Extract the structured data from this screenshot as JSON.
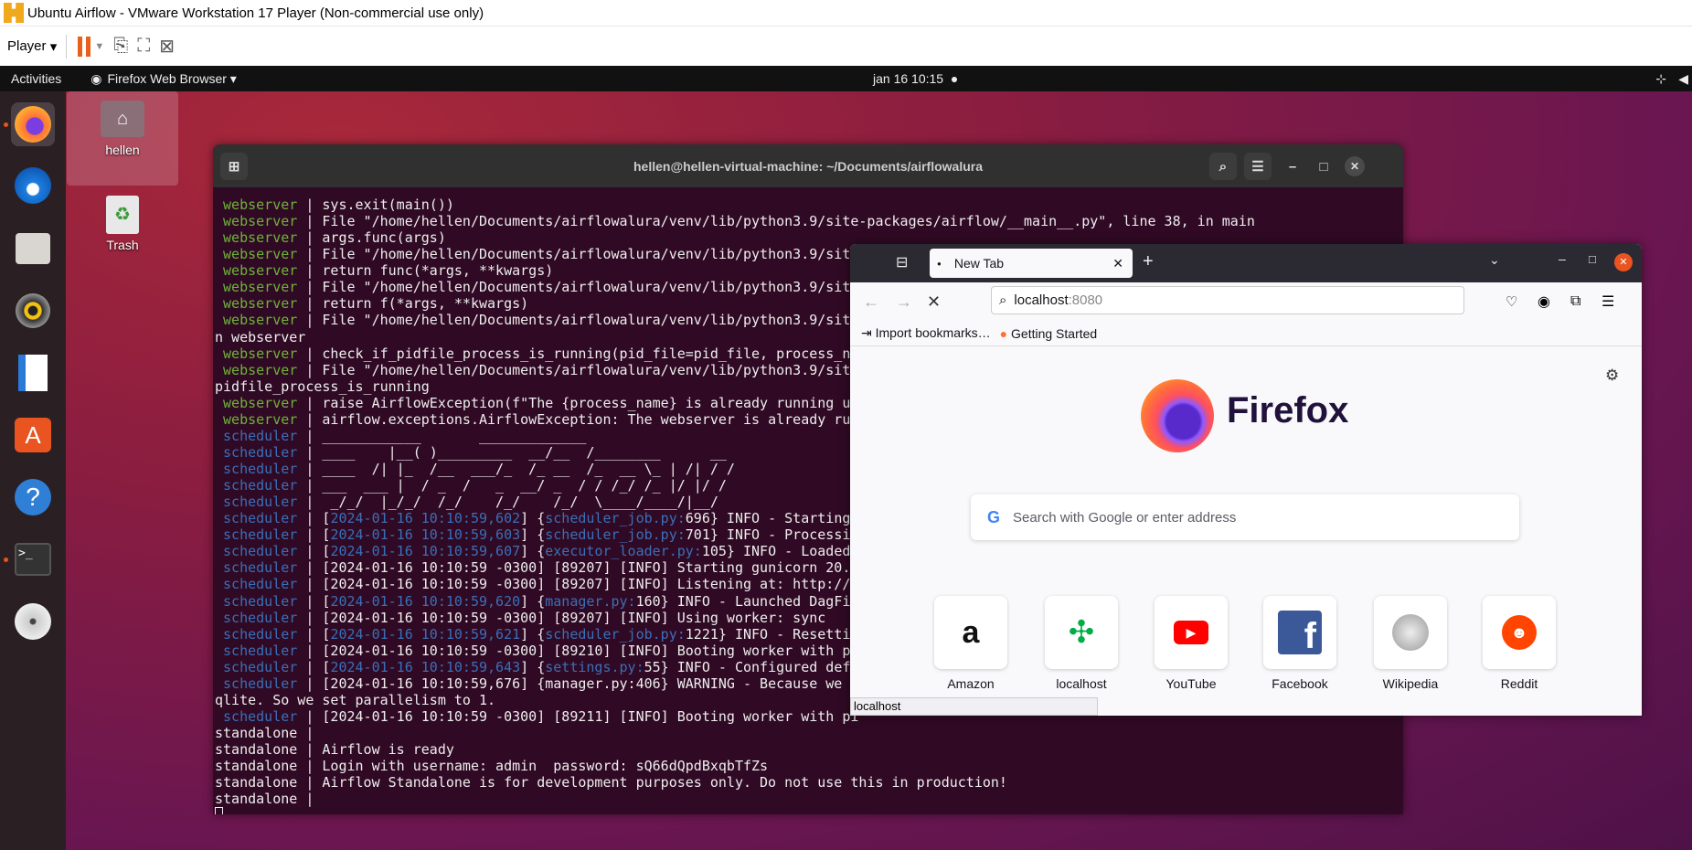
{
  "vm": {
    "title": "Ubuntu Airflow - VMware Workstation 17 Player (Non-commercial use only)",
    "player_menu": "Player"
  },
  "topbar": {
    "activities": "Activities",
    "app": "Firefox Web Browser",
    "clock": "jan 16  10:15"
  },
  "desktop": {
    "home": "hellen",
    "trash": "Trash"
  },
  "dock": [
    "firefox-icon",
    "thunderbird-icon",
    "files-icon",
    "rhythmbox-icon",
    "writer-icon",
    "app-center-icon",
    "help-icon",
    "terminal-icon",
    "dvd-icon"
  ],
  "terminal": {
    "title": "hellen@hellen-virtual-machine: ~/Documents/airflowalura",
    "lines": [
      [
        [
          " webserver",
          "g"
        ],
        [
          " | sys.exit(main())",
          ""
        ]
      ],
      [
        [
          " webserver",
          "g"
        ],
        [
          " | File \"/home/hellen/Documents/airflowalura/venv/lib/python3.9/site-packages/airflow/__main__.py\", line 38, in main",
          ""
        ]
      ],
      [
        [
          " webserver",
          "g"
        ],
        [
          " | args.func(args)",
          ""
        ]
      ],
      [
        [
          " webserver",
          "g"
        ],
        [
          " | File \"/home/hellen/Documents/airflowalura/venv/lib/python3.9/site",
          ""
        ]
      ],
      [
        [
          " webserver",
          "g"
        ],
        [
          " | return func(*args, **kwargs)",
          ""
        ]
      ],
      [
        [
          " webserver",
          "g"
        ],
        [
          " | File \"/home/hellen/Documents/airflowalura/venv/lib/python3.9/site",
          ""
        ]
      ],
      [
        [
          " webserver",
          "g"
        ],
        [
          " | return f(*args, **kwargs)",
          ""
        ]
      ],
      [
        [
          " webserver",
          "g"
        ],
        [
          " | File \"/home/hellen/Documents/airflowalura/venv/lib/python3.9/site",
          ""
        ]
      ],
      [
        [
          "n webserver",
          ""
        ]
      ],
      [
        [
          " webserver",
          "g"
        ],
        [
          " | check_if_pidfile_process_is_running(pid_file=pid_file, process_na",
          ""
        ]
      ],
      [
        [
          " webserver",
          "g"
        ],
        [
          " | File \"/home/hellen/Documents/airflowalura/venv/lib/python3.9/site",
          ""
        ]
      ],
      [
        [
          "pidfile_process_is_running",
          ""
        ]
      ],
      [
        [
          " webserver",
          "g"
        ],
        [
          " | raise AirflowException(f\"The {process_name} is already running u",
          ""
        ]
      ],
      [
        [
          " webserver",
          "g"
        ],
        [
          " | airflow.exceptions.AirflowException: The webserver is already ru",
          ""
        ]
      ],
      [
        [
          " scheduler",
          "b"
        ],
        [
          " | ____________       _____________",
          ""
        ]
      ],
      [
        [
          " scheduler",
          "b"
        ],
        [
          " | ____    |__( )_________  __/__  /________      __",
          ""
        ]
      ],
      [
        [
          " scheduler",
          "b"
        ],
        [
          " | ____  /| |_  /__  ___/_  /_ __  /_  __ \\_ | /| / /",
          ""
        ]
      ],
      [
        [
          " scheduler",
          "b"
        ],
        [
          " | ___  ___ |  / _  /   _  __/ _  / / /_/ /_ |/ |/ /",
          ""
        ]
      ],
      [
        [
          " scheduler",
          "b"
        ],
        [
          " |  _/_/  |_/_/  /_/    /_/    /_/  \\____/____/|__/",
          ""
        ]
      ],
      [
        [
          " scheduler",
          "b"
        ],
        [
          " | [",
          ""
        ],
        [
          "2024-01-16 10:10:59,602",
          "b"
        ],
        [
          "] {",
          ""
        ],
        [
          "scheduler_job.py:",
          "b"
        ],
        [
          "696} INFO - Starting",
          ""
        ]
      ],
      [
        [
          " scheduler",
          "b"
        ],
        [
          " | [",
          ""
        ],
        [
          "2024-01-16 10:10:59,603",
          "b"
        ],
        [
          "] {",
          ""
        ],
        [
          "scheduler_job.py:",
          "b"
        ],
        [
          "701} INFO - Processin",
          ""
        ]
      ],
      [
        [
          " scheduler",
          "b"
        ],
        [
          " | [",
          ""
        ],
        [
          "2024-01-16 10:10:59,607",
          "b"
        ],
        [
          "] {",
          ""
        ],
        [
          "executor_loader.py:",
          "b"
        ],
        [
          "105} INFO - Loaded",
          ""
        ]
      ],
      [
        [
          " scheduler",
          "b"
        ],
        [
          " | [2024-01-16 10:10:59 -0300] [89207] [INFO] Starting gunicorn 20.1",
          ""
        ]
      ],
      [
        [
          " scheduler",
          "b"
        ],
        [
          " | [2024-01-16 10:10:59 -0300] [89207] [INFO] Listening at: http://0",
          ""
        ]
      ],
      [
        [
          " scheduler",
          "b"
        ],
        [
          " | [",
          ""
        ],
        [
          "2024-01-16 10:10:59,620",
          "b"
        ],
        [
          "] {",
          ""
        ],
        [
          "manager.py:",
          "b"
        ],
        [
          "160} INFO - Launched DagFil",
          ""
        ]
      ],
      [
        [
          " scheduler",
          "b"
        ],
        [
          " | [2024-01-16 10:10:59 -0300] [89207] [INFO] Using worker: sync",
          ""
        ]
      ],
      [
        [
          " scheduler",
          "b"
        ],
        [
          " | [",
          ""
        ],
        [
          "2024-01-16 10:10:59,621",
          "b"
        ],
        [
          "] {",
          ""
        ],
        [
          "scheduler_job.py:",
          "b"
        ],
        [
          "1221} INFO - Resettin",
          ""
        ]
      ],
      [
        [
          " scheduler",
          "b"
        ],
        [
          " | [2024-01-16 10:10:59 -0300] [89210] [INFO] Booting worker with pi",
          ""
        ]
      ],
      [
        [
          " scheduler",
          "b"
        ],
        [
          " | [",
          ""
        ],
        [
          "2024-01-16 10:10:59,643",
          "b"
        ],
        [
          "] {",
          ""
        ],
        [
          "settings.py:",
          "b"
        ],
        [
          "55} INFO - Configured defa",
          ""
        ]
      ],
      [
        [
          " scheduler",
          "b"
        ],
        [
          " | [2024-01-16 10:10:59,676] {manager.py:406} WARNING - Because we c",
          ""
        ]
      ],
      [
        [
          "qlite. So we set parallelism to 1.",
          ""
        ]
      ],
      [
        [
          " scheduler",
          "b"
        ],
        [
          " | [2024-01-16 10:10:59 -0300] [89211] [INFO] Booting worker with pi",
          ""
        ]
      ],
      [
        [
          "standalone |",
          ""
        ]
      ],
      [
        [
          "standalone | Airflow is ready",
          ""
        ]
      ],
      [
        [
          "standalone | Login with username: admin  password: sQ66dQpdBxqbTfZs",
          ""
        ]
      ],
      [
        [
          "standalone | Airflow Standalone is for development purposes only. Do not use this in production!",
          ""
        ]
      ],
      [
        [
          "standalone |",
          ""
        ]
      ]
    ]
  },
  "firefox": {
    "tab": "New Tab",
    "url_host": "localhost",
    "url_port": ":8080",
    "bookmarks": [
      "Import bookmarks…",
      "Getting Started"
    ],
    "brand": "Firefox",
    "search_placeholder": "Search with Google or enter address",
    "shortcuts": [
      "Amazon",
      "localhost",
      "YouTube",
      "Facebook",
      "Wikipedia",
      "Reddit"
    ],
    "status": "localhost"
  }
}
